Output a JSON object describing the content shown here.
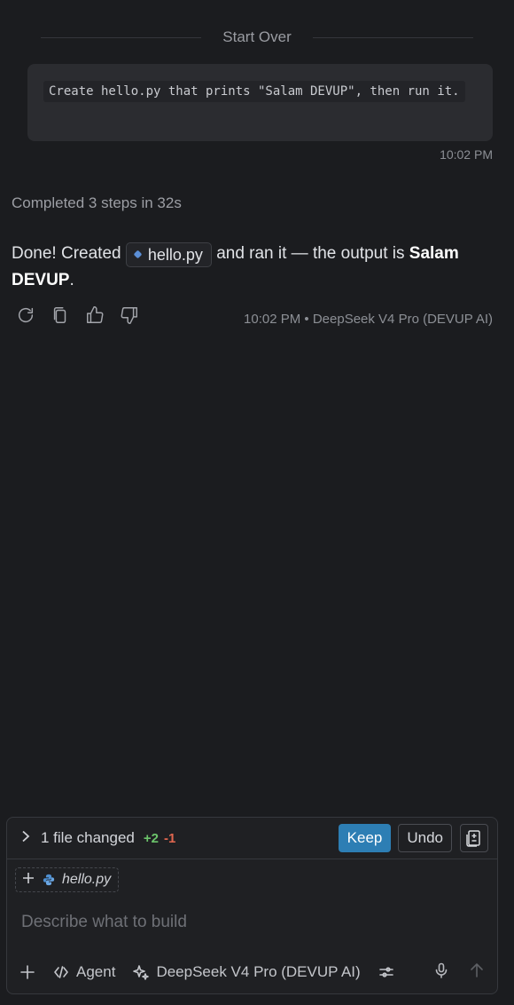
{
  "divider": {
    "label": "Start Over"
  },
  "user_message": {
    "text": "Create hello.py that prints \"Salam DEVUP\", then run it.",
    "time": "10:02 PM"
  },
  "assistant": {
    "steps_summary": "Completed 3 steps in 32s",
    "answer_prefix": "Done! Created",
    "file_chip": "hello.py",
    "answer_middle": "and ran it — the output is",
    "answer_bold": "Salam DEVUP",
    "answer_suffix": ".",
    "meta": "10:02 PM • DeepSeek V4 Pro (DEVUP AI)",
    "actions": [
      "refresh-icon",
      "copy-icon",
      "thumbs-up-icon",
      "thumbs-down-icon"
    ]
  },
  "composer": {
    "changes_label": "1 file changed",
    "additions": "+2",
    "deletions": "-1",
    "keep_label": "Keep",
    "undo_label": "Undo",
    "attachment": "hello.py",
    "placeholder": "Describe what to build",
    "mode_label": "Agent",
    "model_label": "DeepSeek V4 Pro (DEVUP AI)"
  },
  "colors": {
    "background": "#1b1c1f",
    "accent": "#2d7eb4",
    "additions": "#6cc46b",
    "deletions": "#e0664f"
  }
}
